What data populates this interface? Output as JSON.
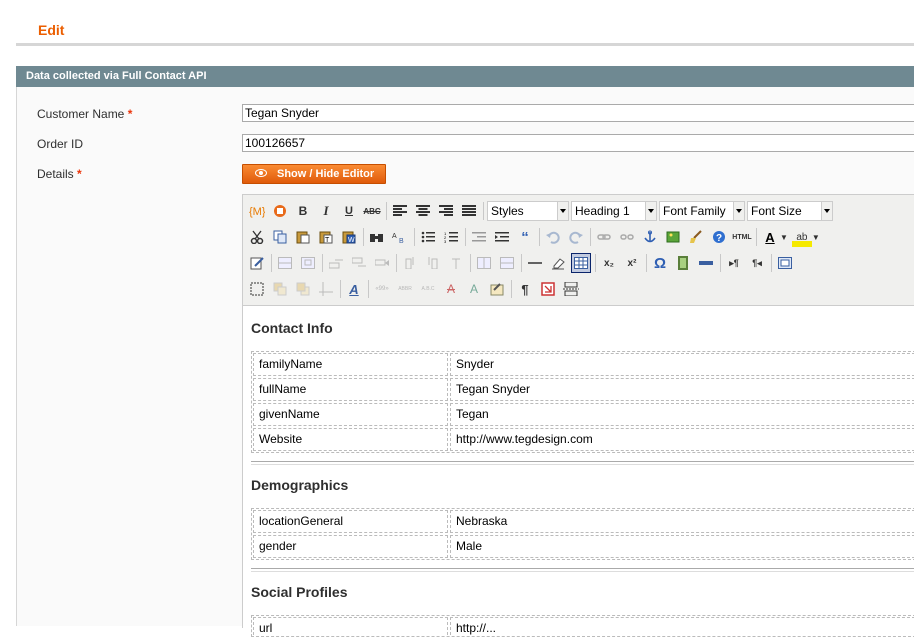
{
  "page": {
    "title": "Edit"
  },
  "section": {
    "title": "Data collected via Full Contact API"
  },
  "form": {
    "customer_name_label": "Customer Name",
    "customer_name_value": "Tegan Snyder",
    "order_id_label": "Order ID",
    "order_id_value": "100126657",
    "details_label": "Details",
    "required_mark": "*",
    "show_hide_label": "Show / Hide Editor"
  },
  "editor": {
    "styles_select": "Styles",
    "format_select": "Heading 1",
    "font_family_select": "Font Family",
    "font_size_select": "Font Size",
    "toolbar_text": {
      "bold": "B",
      "italic": "I",
      "underline": "U",
      "strike": "ABC",
      "html": "HTML",
      "quote": "“",
      "omega": "Ω",
      "subscript": "x₂",
      "superscript": "x²",
      "pilcrow": "¶",
      "font_color": "A",
      "bg_color": "ab"
    },
    "sections": [
      {
        "heading": "Contact Info",
        "rows": [
          [
            "familyName",
            "Snyder"
          ],
          [
            "fullName",
            "Tegan Snyder"
          ],
          [
            "givenName",
            "Tegan"
          ],
          [
            "Website",
            "http://www.tegdesign.com"
          ]
        ]
      },
      {
        "heading": "Demographics",
        "rows": [
          [
            "locationGeneral",
            "Nebraska"
          ],
          [
            "gender",
            "Male"
          ]
        ]
      },
      {
        "heading": "Social Profiles",
        "rows": [
          [
            "url",
            "http://..."
          ]
        ]
      }
    ]
  }
}
